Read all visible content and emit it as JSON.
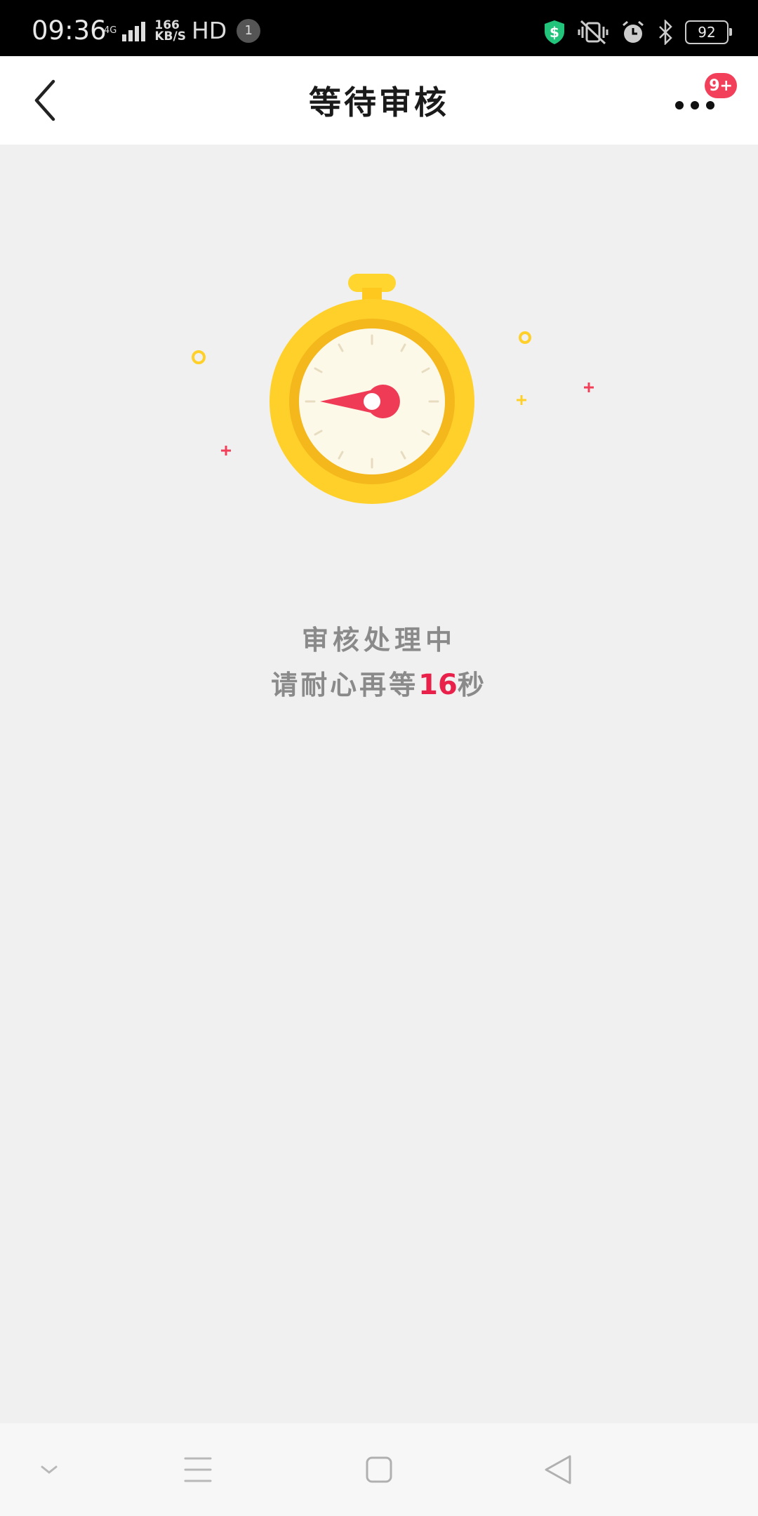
{
  "status_bar": {
    "time": "09:36",
    "network_type": "4G",
    "speed_value": "166",
    "speed_unit": "KB/S",
    "hd_label": "HD",
    "notification_count": "1",
    "battery": "92",
    "icons": [
      "shield-dollar-icon",
      "vibrate-mute-icon",
      "alarm-icon",
      "bluetooth-icon"
    ]
  },
  "header": {
    "title": "等待审核",
    "badge": "9+",
    "back_icon": "chevron-left-icon",
    "more_icon": "more-dots-icon"
  },
  "main": {
    "illustration_icon": "stopwatch-icon",
    "status_title": "审核处理中",
    "wait_prefix": "请耐心再等",
    "countdown_seconds": "16",
    "wait_suffix": "秒"
  },
  "nav": {
    "icons": [
      "collapse-icon",
      "menu-icon",
      "home-square-icon",
      "back-triangle-icon"
    ]
  },
  "colors": {
    "accent_red": "#e8204a",
    "stopwatch_yellow": "#ffd02a",
    "background": "#f0f0f0"
  }
}
